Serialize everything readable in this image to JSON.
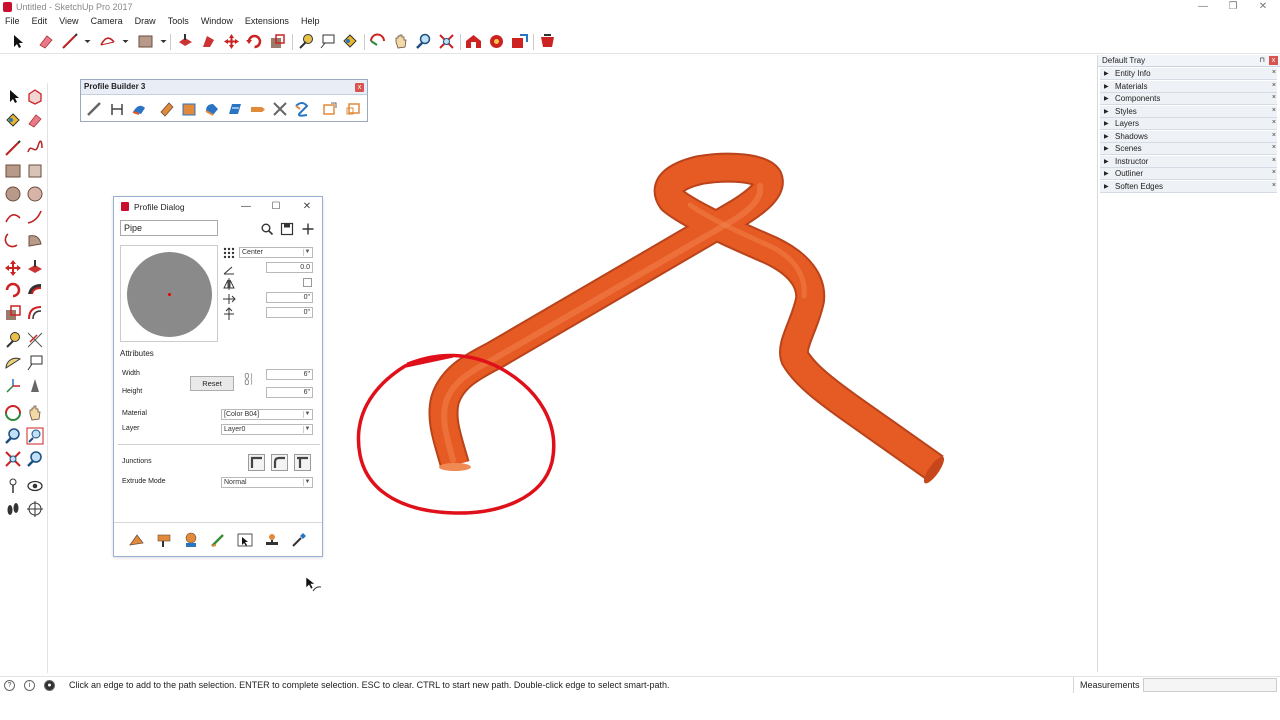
{
  "window": {
    "title": "Untitled - SketchUp Pro 2017",
    "minimize": "—",
    "restore": "❐",
    "close": "✕"
  },
  "menu": [
    "File",
    "Edit",
    "View",
    "Camera",
    "Draw",
    "Tools",
    "Window",
    "Extensions",
    "Help"
  ],
  "profile_builder_toolbar": {
    "title": "Profile Builder 3",
    "close": "x"
  },
  "profile_dialog": {
    "title": "Profile Dialog",
    "minimize": "—",
    "maximize": "☐",
    "close": "✕",
    "profile_name": "Pipe",
    "alignment": "Center",
    "rotation": "0.0",
    "offset_x": "0\"",
    "offset_y": "0\"",
    "attributes_heading": "Attributes",
    "width_label": "Width",
    "width_value": "6\"",
    "height_label": "Height",
    "height_value": "6\"",
    "reset_label": "Reset",
    "material_label": "Material",
    "material_value": "[Color B04]",
    "layer_label": "Layer",
    "layer_value": "Layer0",
    "junctions_label": "Junctions",
    "extrude_mode_label": "Extrude Mode",
    "extrude_mode_value": "Normal"
  },
  "tray": {
    "title": "Default Tray",
    "pin": "⊓",
    "close": "x",
    "items": [
      {
        "label": "Entity Info"
      },
      {
        "label": "Materials"
      },
      {
        "label": "Components"
      },
      {
        "label": "Styles"
      },
      {
        "label": "Layers"
      },
      {
        "label": "Shadows"
      },
      {
        "label": "Scenes"
      },
      {
        "label": "Instructor"
      },
      {
        "label": "Outliner"
      },
      {
        "label": "Soften Edges"
      }
    ]
  },
  "status": {
    "message": "Click an edge to add to the path selection. ENTER to complete selection. ESC to clear. CTRL to start new path. Double-click edge to select smart-path.",
    "measurements_label": "Measurements",
    "measurements_value": ""
  },
  "colors": {
    "pipe": "#e65a24",
    "annotation": "#e0101a",
    "brand": "#c8102e"
  }
}
